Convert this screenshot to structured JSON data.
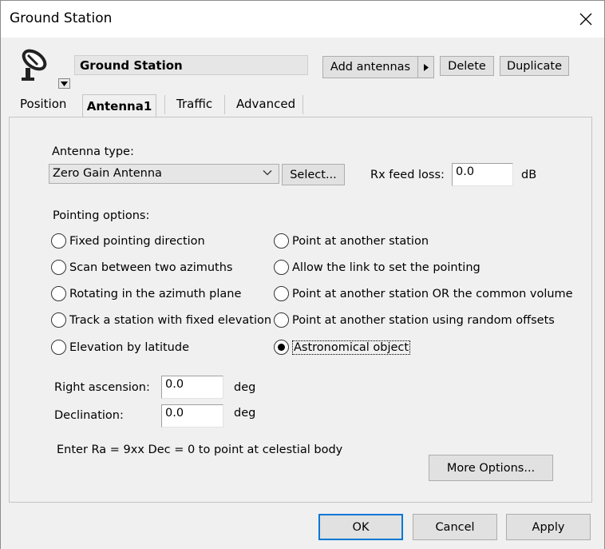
{
  "window": {
    "title": "Ground Station"
  },
  "header": {
    "station_name": "Ground Station",
    "add_antennas_label": "Add antennas",
    "delete_label": "Delete",
    "duplicate_label": "Duplicate"
  },
  "tabs": [
    {
      "label": "Position"
    },
    {
      "label": "Antenna1"
    },
    {
      "label": "Traffic"
    },
    {
      "label": "Advanced"
    }
  ],
  "antenna": {
    "type_label": "Antenna type:",
    "type_value": "Zero Gain Antenna",
    "select_label": "Select...",
    "rx_feed_loss_label": "Rx feed loss:",
    "rx_feed_loss_value": "0.0",
    "rx_feed_loss_unit": "dB"
  },
  "pointing": {
    "label": "Pointing options:",
    "left_options": [
      "Fixed pointing direction",
      "Scan between two azimuths",
      "Rotating in the azimuth plane",
      "Track a station with fixed elevation",
      "Elevation by latitude"
    ],
    "right_options": [
      "Point at another station",
      "Allow the link to set the pointing",
      "Point at another station OR the common volume",
      "Point at another station using random offsets",
      "Astronomical object"
    ],
    "selected": "Astronomical object"
  },
  "astro": {
    "ra_label": "Right ascension:",
    "ra_value": "0.0",
    "ra_unit": "deg",
    "dec_label": "Declination:",
    "dec_value": "0.0",
    "dec_unit": "deg",
    "hint": "Enter Ra = 9xx Dec = 0 to point at celestial body",
    "more_options_label": "More Options..."
  },
  "footer": {
    "ok_label": "OK",
    "cancel_label": "Cancel",
    "apply_label": "Apply"
  },
  "colors": {
    "focus_border": "#0078d7",
    "window_bg": "#f0f0f0"
  },
  "icons": {
    "station_icon": "satellite-dish-icon",
    "close": "close-icon"
  }
}
